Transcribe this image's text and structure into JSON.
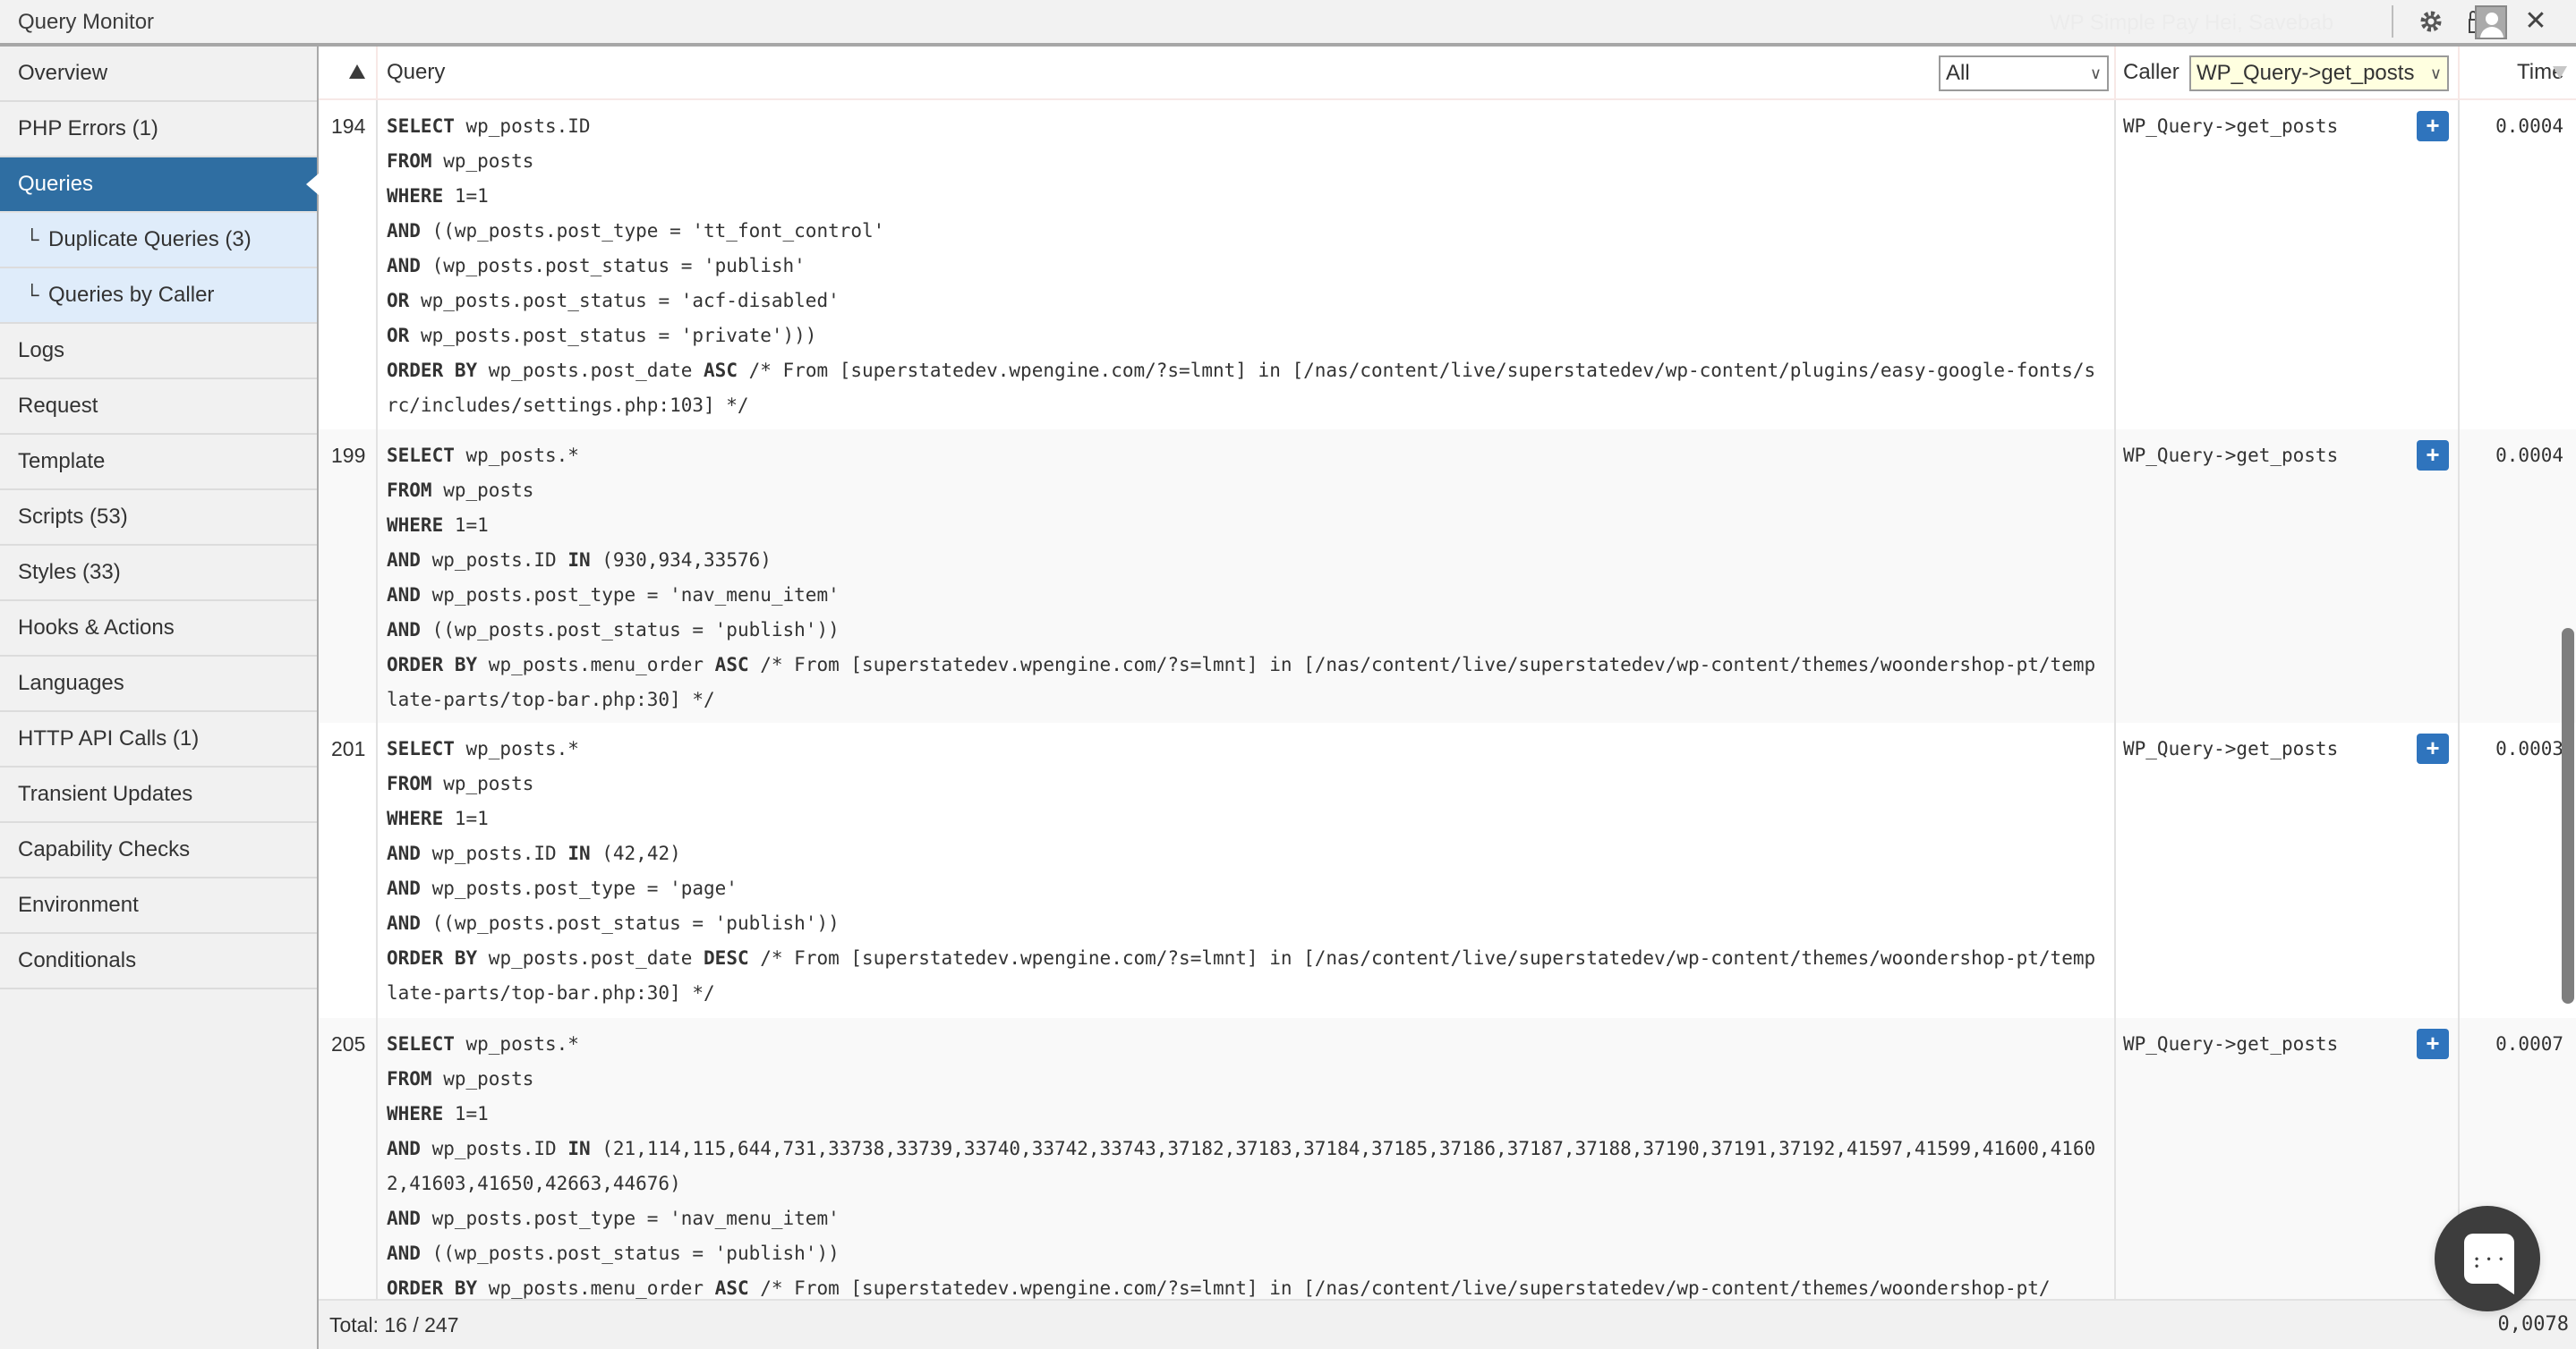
{
  "titlebar": {
    "title": "Query Monitor",
    "ghost_text": "WP Simple Pay    Hei, Savebab",
    "icons": [
      "gear-icon",
      "lock-icon",
      "avatar-icon",
      "close-icon"
    ],
    "close_glyph": "✕"
  },
  "sidebar": {
    "items": [
      {
        "label": "Overview"
      },
      {
        "label": "PHP Errors (1)"
      },
      {
        "label": "Queries",
        "active": true
      },
      {
        "label": "Duplicate Queries (3)",
        "sub": true
      },
      {
        "label": "Queries by Caller",
        "sub": true
      },
      {
        "label": "Logs"
      },
      {
        "label": "Request"
      },
      {
        "label": "Template"
      },
      {
        "label": "Scripts (53)"
      },
      {
        "label": "Styles (33)"
      },
      {
        "label": "Hooks & Actions"
      },
      {
        "label": "Languages"
      },
      {
        "label": "HTTP API Calls (1)"
      },
      {
        "label": "Transient Updates"
      },
      {
        "label": "Capability Checks"
      },
      {
        "label": "Environment"
      },
      {
        "label": "Conditionals"
      }
    ],
    "sub_elbow": "└"
  },
  "table": {
    "headers": {
      "query": "Query",
      "type_filter": "All",
      "caller": "Caller",
      "caller_filter": "WP_Query->get_posts",
      "time": "Time",
      "chevron": "∨"
    },
    "rows": [
      {
        "num": "194",
        "lines": [
          [
            [
              "SELECT",
              true
            ],
            [
              " wp_posts.ID",
              false
            ]
          ],
          [
            [
              "FROM",
              true
            ],
            [
              " wp_posts",
              false
            ]
          ],
          [
            [
              "WHERE",
              true
            ],
            [
              " 1=1",
              false
            ]
          ],
          [
            [
              "AND",
              true
            ],
            [
              " ((wp_posts.post_type = 'tt_font_control'",
              false
            ]
          ],
          [
            [
              "AND",
              true
            ],
            [
              " (wp_posts.post_status = 'publish'",
              false
            ]
          ],
          [
            [
              "OR",
              true
            ],
            [
              " wp_posts.post_status = 'acf-disabled'",
              false
            ]
          ],
          [
            [
              "OR",
              true
            ],
            [
              " wp_posts.post_status = 'private')))",
              false
            ]
          ],
          [
            [
              "ORDER BY",
              true
            ],
            [
              " wp_posts.post_date ",
              false
            ],
            [
              "ASC",
              true
            ],
            [
              " /* From [superstatedev.wpengine.com/?s=lmnt] in [/nas/content/live/superstatedev/wp-content/plugins/easy-google-fonts/src/includes/settings.php:103] */",
              false
            ]
          ]
        ],
        "caller": "WP_Query->get_posts",
        "time": "0.0004"
      },
      {
        "num": "199",
        "lines": [
          [
            [
              "SELECT",
              true
            ],
            [
              " wp_posts.*",
              false
            ]
          ],
          [
            [
              "FROM",
              true
            ],
            [
              " wp_posts",
              false
            ]
          ],
          [
            [
              "WHERE",
              true
            ],
            [
              " 1=1",
              false
            ]
          ],
          [
            [
              "AND",
              true
            ],
            [
              " wp_posts.ID ",
              false
            ],
            [
              "IN",
              true
            ],
            [
              " (930,934,33576)",
              false
            ]
          ],
          [
            [
              "AND",
              true
            ],
            [
              " wp_posts.post_type = 'nav_menu_item'",
              false
            ]
          ],
          [
            [
              "AND",
              true
            ],
            [
              " ((wp_posts.post_status = 'publish'))",
              false
            ]
          ],
          [
            [
              "ORDER BY",
              true
            ],
            [
              " wp_posts.menu_order ",
              false
            ],
            [
              "ASC",
              true
            ],
            [
              " /* From [superstatedev.wpengine.com/?s=lmnt] in [/nas/content/live/superstatedev/wp-content/themes/woondershop-pt/template-parts/top-bar.php:30] */",
              false
            ]
          ]
        ],
        "caller": "WP_Query->get_posts",
        "time": "0.0004"
      },
      {
        "num": "201",
        "lines": [
          [
            [
              "SELECT",
              true
            ],
            [
              " wp_posts.*",
              false
            ]
          ],
          [
            [
              "FROM",
              true
            ],
            [
              " wp_posts",
              false
            ]
          ],
          [
            [
              "WHERE",
              true
            ],
            [
              " 1=1",
              false
            ]
          ],
          [
            [
              "AND",
              true
            ],
            [
              " wp_posts.ID ",
              false
            ],
            [
              "IN",
              true
            ],
            [
              " (42,42)",
              false
            ]
          ],
          [
            [
              "AND",
              true
            ],
            [
              " wp_posts.post_type = 'page'",
              false
            ]
          ],
          [
            [
              "AND",
              true
            ],
            [
              " ((wp_posts.post_status = 'publish'))",
              false
            ]
          ],
          [
            [
              "ORDER BY",
              true
            ],
            [
              " wp_posts.post_date ",
              false
            ],
            [
              "DESC",
              true
            ],
            [
              " /* From [superstatedev.wpengine.com/?s=lmnt] in [/nas/content/live/superstatedev/wp-content/themes/woondershop-pt/template-parts/top-bar.php:30] */",
              false
            ]
          ]
        ],
        "caller": "WP_Query->get_posts",
        "time": "0.0003"
      },
      {
        "num": "205",
        "lines": [
          [
            [
              "SELECT",
              true
            ],
            [
              " wp_posts.*",
              false
            ]
          ],
          [
            [
              "FROM",
              true
            ],
            [
              " wp_posts",
              false
            ]
          ],
          [
            [
              "WHERE",
              true
            ],
            [
              " 1=1",
              false
            ]
          ],
          [
            [
              "AND",
              true
            ],
            [
              " wp_posts.ID ",
              false
            ],
            [
              "IN",
              true
            ],
            [
              " (21,114,115,644,731,33738,33739,33740,33742,33743,37182,37183,37184,37185,37186,37187,37188,37190,37191,37192,41597,41599,41600,41602,41603,41650,42663,44676)",
              false
            ]
          ],
          [
            [
              "AND",
              true
            ],
            [
              " wp_posts.post_type = 'nav_menu_item'",
              false
            ]
          ],
          [
            [
              "AND",
              true
            ],
            [
              " ((wp_posts.post_status = 'publish'))",
              false
            ]
          ],
          [
            [
              "ORDER BY",
              true
            ],
            [
              " wp_posts.menu_order ",
              false
            ],
            [
              "ASC",
              true
            ],
            [
              " /* From [superstatedev.wpengine.com/?s=lmnt] in [/nas/content/live/superstatedev/wp-content/themes/woondershop-pt/",
              false
            ]
          ]
        ],
        "caller": "WP_Query->get_posts",
        "time": "0.0007"
      }
    ],
    "expand_label": "+"
  },
  "footer": {
    "total": "Total: 16 / 247",
    "time_sum": "0,0078"
  },
  "colors": {
    "accent": "#2f6ea2",
    "button": "#2f74bd",
    "caller_filter_bg": "#ffffe0",
    "sub_item_bg": "#dfecfa"
  }
}
